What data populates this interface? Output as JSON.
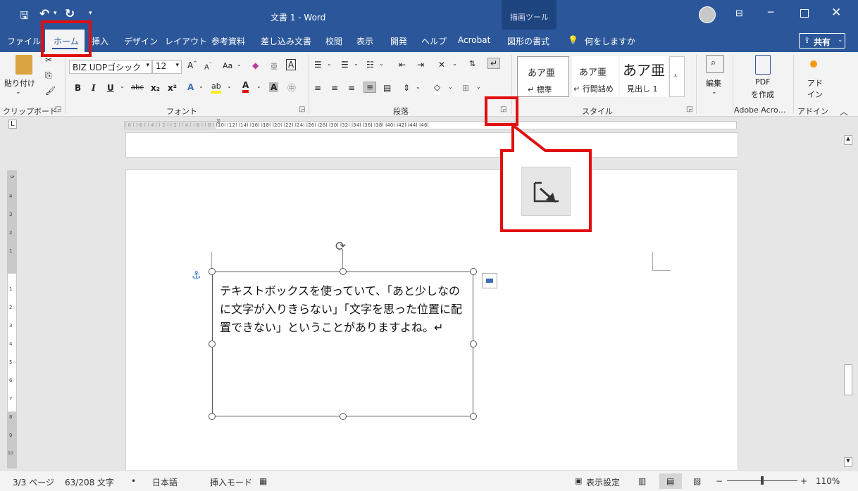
{
  "titlebar": {
    "save_icon": "save-icon",
    "undo_icon": "undo-icon",
    "redo_icon": "redo-icon",
    "title": "文書 1  -  Word",
    "context_tab": "描画ツール"
  },
  "tabs": [
    "ファイル",
    "ホーム",
    "挿入",
    "デザイン",
    "レイアウト",
    "参考資料",
    "差し込み文書",
    "校閲",
    "表示",
    "開発",
    "ヘルプ",
    "Acrobat",
    "図形の書式"
  ],
  "tell_me": "何をしますか",
  "share": "共有",
  "ribbon": {
    "clipboard": {
      "paste": "貼り付け",
      "label": "クリップボード"
    },
    "font": {
      "name": "BIZ UDPゴシック",
      "size": "12",
      "aa": "Aa",
      "bold": "B",
      "italic": "I",
      "underline": "U",
      "strike": "abc",
      "sub": "x₂",
      "sup": "x²",
      "label": "フォント"
    },
    "paragraph": {
      "label": "段落"
    },
    "styles": {
      "items": [
        {
          "sample": "あア亜",
          "name": "↵ 標準"
        },
        {
          "sample": "あア亜",
          "name": "↵ 行間詰め"
        },
        {
          "sample": "あア亜",
          "name": "見出し 1"
        }
      ],
      "label": "スタイル"
    },
    "editing": {
      "label": "編集"
    },
    "pdf": {
      "line1": "PDF",
      "line2": "を作成",
      "group": "Adobe Acro…"
    },
    "addin": {
      "line1": "アド",
      "line2": "イン",
      "group": "アドイン"
    }
  },
  "ruler": {
    "marks": "l 8 l   l 6 l   l 4 l   l 2 l       l 2 l   l 4 l   l 6 l   l 8 l   l10l  l12l  l14l  l16l  l18l  l20l  l22l  l24l  l26l  l28l  l30l  l32l  l34l  l36l  l38l  l40l  l42l  l44l  l46l"
  },
  "vruler": [
    "5",
    "4",
    "3",
    "2",
    "1",
    "1",
    "2",
    "3",
    "4",
    "5",
    "6",
    "7",
    "8",
    "9",
    "10"
  ],
  "document": {
    "textbox": "テキストボックスを使っていて、「あと少しなのに文字が入りきらない」「文字を思った位置に配置できない」ということがありますよね。↵"
  },
  "status": {
    "page": "3/3 ページ",
    "words": "63/208 文字",
    "bullet": "•",
    "lang": "日本語",
    "mode": "挿入モード",
    "display": "表示設定",
    "zoom_minus": "−",
    "zoom_plus": "+",
    "zoom": "110%"
  },
  "callout_icon": "dialog-launcher-icon",
  "colors": {
    "accent": "#2b579a",
    "highlight": "#e01010"
  }
}
